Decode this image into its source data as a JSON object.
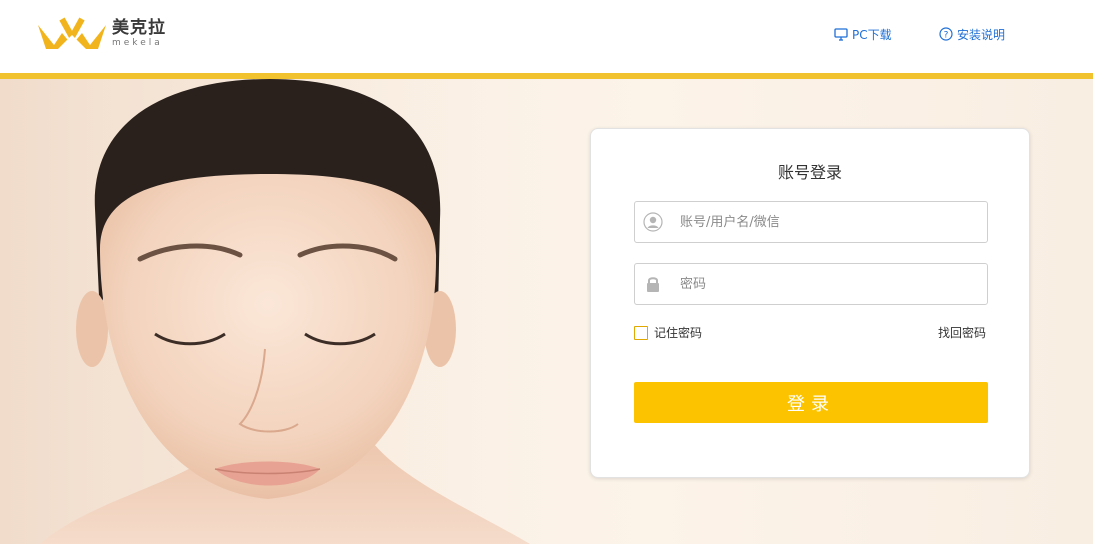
{
  "brand": {
    "name_cn": "美克拉",
    "name_en": "mekela",
    "logo_color": "#f2b41c"
  },
  "header": {
    "nav": [
      {
        "label": "PC下载",
        "icon": "monitor-icon"
      },
      {
        "label": "安装说明",
        "icon": "help-circle-icon"
      }
    ],
    "accent_bar_color": "#f2c12e"
  },
  "login": {
    "title": "账号登录",
    "username": {
      "placeholder": "账号/用户名/微信",
      "value": "",
      "icon": "user-icon"
    },
    "password": {
      "placeholder": "密码",
      "value": "",
      "icon": "lock-icon"
    },
    "remember_label": "记住密码",
    "remember_checked": false,
    "forgot_label": "找回密码",
    "submit_label": "登录",
    "button_color": "#fcc400"
  }
}
